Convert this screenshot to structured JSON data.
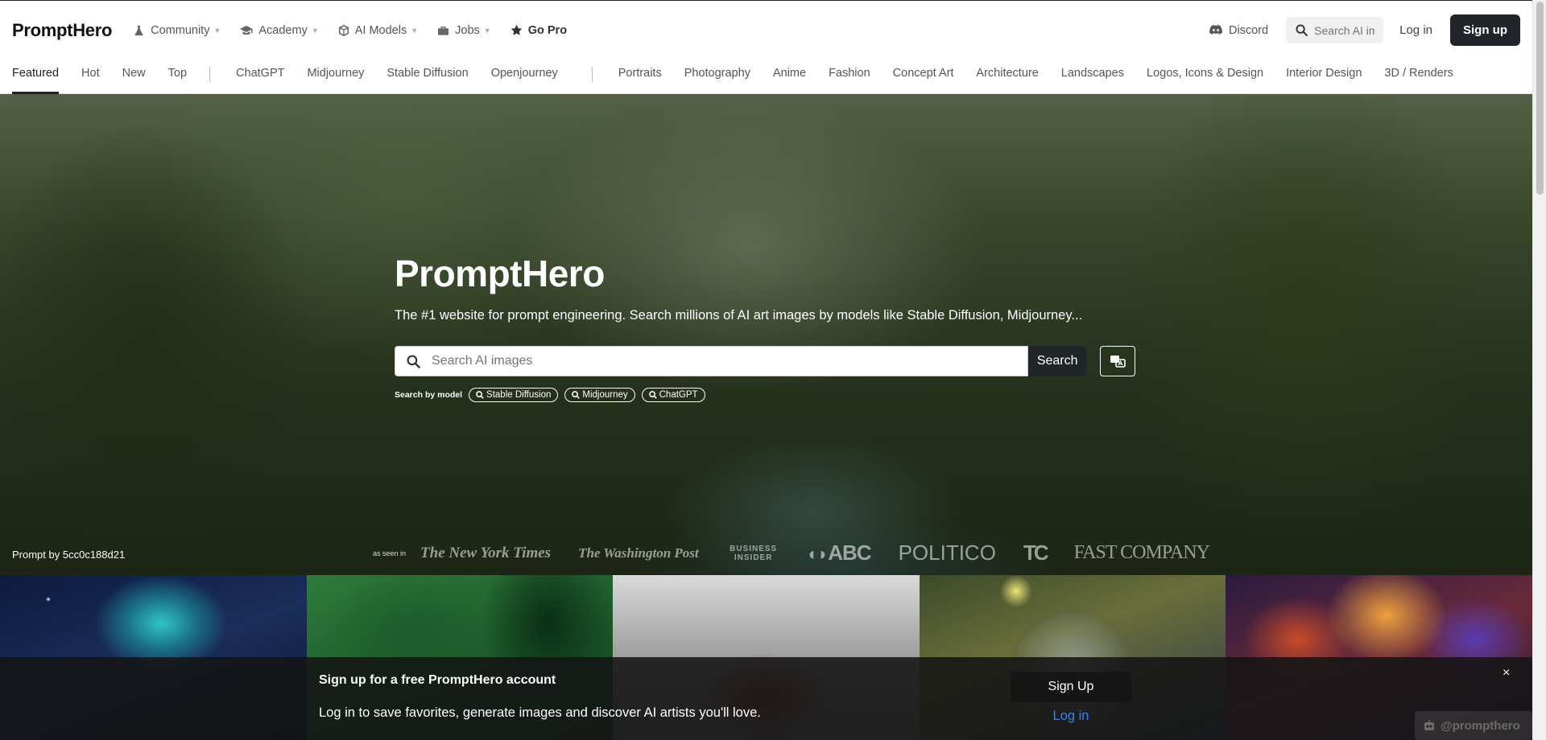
{
  "brand": "PromptHero",
  "topnav": {
    "items": [
      {
        "label": "Community",
        "icon": "flask-icon",
        "dropdown": true
      },
      {
        "label": "Academy",
        "icon": "graduation-cap-icon",
        "dropdown": true
      },
      {
        "label": "AI Models",
        "icon": "cube-icon",
        "dropdown": true
      },
      {
        "label": "Jobs",
        "icon": "briefcase-icon",
        "dropdown": true
      }
    ],
    "pro_label": "Go Pro",
    "discord_label": "Discord",
    "search_placeholder": "Search AI images",
    "login_label": "Log in",
    "signup_label": "Sign up"
  },
  "categories": {
    "group1": [
      "Featured",
      "Hot",
      "New",
      "Top"
    ],
    "group2": [
      "ChatGPT",
      "Midjourney",
      "Stable Diffusion",
      "Openjourney"
    ],
    "group3": [
      "Portraits",
      "Photography",
      "Anime",
      "Fashion",
      "Concept Art",
      "Architecture",
      "Landscapes",
      "Logos, Icons & Design",
      "Interior Design",
      "3D / Renders"
    ],
    "active": "Featured"
  },
  "hero": {
    "title": "PromptHero",
    "subtitle": "The #1 website for prompt engineering. Search millions of AI art images by models like Stable Diffusion, Midjourney...",
    "search_placeholder": "Search AI images",
    "search_button": "Search",
    "model_label": "Search by model",
    "models": [
      "Stable Diffusion",
      "Midjourney",
      "ChatGPT"
    ],
    "prompt_by": "Prompt by 5cc0c188d21",
    "press_label": "as seen in",
    "press": [
      "The New York Times",
      "The Washington Post",
      "BUSINESS INSIDER",
      "ABC",
      "POLITICO",
      "TC",
      "FAST COMPANY"
    ]
  },
  "banner": {
    "title": "Sign up for a free PromptHero account",
    "text": "Log in to save favorites, generate images and discover AI artists you'll love.",
    "signup_label": "Sign Up",
    "login_label": "Log in",
    "close_label": "×"
  },
  "watermark": "@prompthero"
}
